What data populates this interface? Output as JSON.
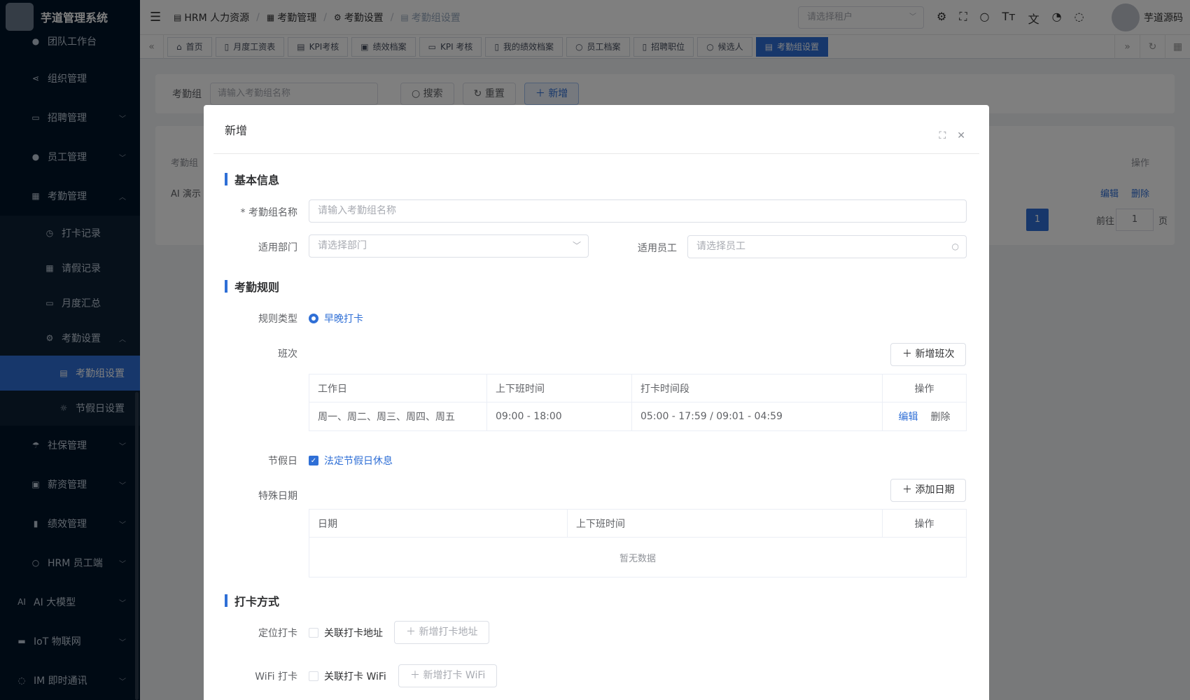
{
  "app": {
    "title": "芋道管理系统"
  },
  "sidebar": {
    "items": [
      {
        "label": "团队工作台",
        "icon": "user-icon"
      },
      {
        "label": "组织管理",
        "icon": "share-icon"
      },
      {
        "label": "招聘管理",
        "icon": "briefcase-icon"
      },
      {
        "label": "员工管理",
        "icon": "user-icon"
      },
      {
        "label": "考勤管理",
        "icon": "calendar-icon"
      },
      {
        "label": "打卡记录",
        "icon": "clock-icon"
      },
      {
        "label": "请假记录",
        "icon": "calendar-icon"
      },
      {
        "label": "月度汇总",
        "icon": "chart-icon"
      },
      {
        "label": "考勤设置",
        "icon": "gear-icon"
      },
      {
        "label": "考勤组设置",
        "icon": "building-icon"
      },
      {
        "label": "节假日设置",
        "icon": "sun-icon"
      },
      {
        "label": "社保管理",
        "icon": "umbrella-icon"
      },
      {
        "label": "薪资管理",
        "icon": "wallet-icon"
      },
      {
        "label": "绩效管理",
        "icon": "bar-chart-icon"
      },
      {
        "label": "HRM 员工端",
        "icon": "user-icon"
      },
      {
        "label": "AI 大模型",
        "icon": "ai-icon"
      },
      {
        "label": "IoT 物联网",
        "icon": "iot-icon"
      },
      {
        "label": "IM 即时通讯",
        "icon": "chat-icon"
      }
    ]
  },
  "navbar": {
    "breadcrumb": [
      "HRM 人力资源",
      "考勤管理",
      "考勤设置",
      "考勤组设置"
    ],
    "tenant_placeholder": "请选择租户",
    "username": "芋道源码"
  },
  "tags": [
    "首页",
    "月度工资表",
    "KPI考核",
    "绩效档案",
    "KPI 考核",
    "我的绩效档案",
    "员工档案",
    "招聘职位",
    "候选人",
    "考勤组设置"
  ],
  "search": {
    "label": "考勤组",
    "placeholder": "请输入考勤组名称",
    "search_btn": "搜索",
    "reset_btn": "重置",
    "add_btn": "新增"
  },
  "bg_table": {
    "col1": "考勤组",
    "col_op": "操作",
    "row1": "AI 演示",
    "edit": "编辑",
    "delete": "删除",
    "page": "1",
    "goto": "前往",
    "goto_val": "1",
    "page_unit": "页"
  },
  "dialog": {
    "title": "新增",
    "sec_basic": "基本信息",
    "name_label": "* 考勤组名称",
    "name_placeholder": "请输入考勤组名称",
    "dept_label": "适用部门",
    "dept_placeholder": "请选择部门",
    "emp_label": "适用员工",
    "emp_placeholder": "请选择员工",
    "sec_rules": "考勤规则",
    "rule_type_label": "规则类型",
    "rule_type_value": "早晚打卡",
    "shift_label": "班次",
    "add_shift_btn": "新增班次",
    "shift_table": {
      "headers": [
        "工作日",
        "上下班时间",
        "打卡时间段",
        "操作"
      ],
      "rows": [
        {
          "days": "周一、周二、周三、周四、周五",
          "time": "09:00 - 18:00",
          "range": "05:00 - 17:59 / 09:01 - 04:59",
          "edit": "编辑",
          "delete": "删除"
        }
      ]
    },
    "holiday_label": "节假日",
    "holiday_value": "法定节假日休息",
    "special_label": "特殊日期",
    "add_date_btn": "添加日期",
    "special_table": {
      "headers": [
        "日期",
        "上下班时间",
        "操作"
      ],
      "empty": "暂无数据"
    },
    "sec_punch": "打卡方式",
    "location_label": "定位打卡",
    "location_chk": "关联打卡地址",
    "add_location_btn": "新增打卡地址",
    "wifi_label": "WiFi 打卡",
    "wifi_chk": "关联打卡 WiFi",
    "add_wifi_btn": "新增打卡 WiFi"
  }
}
